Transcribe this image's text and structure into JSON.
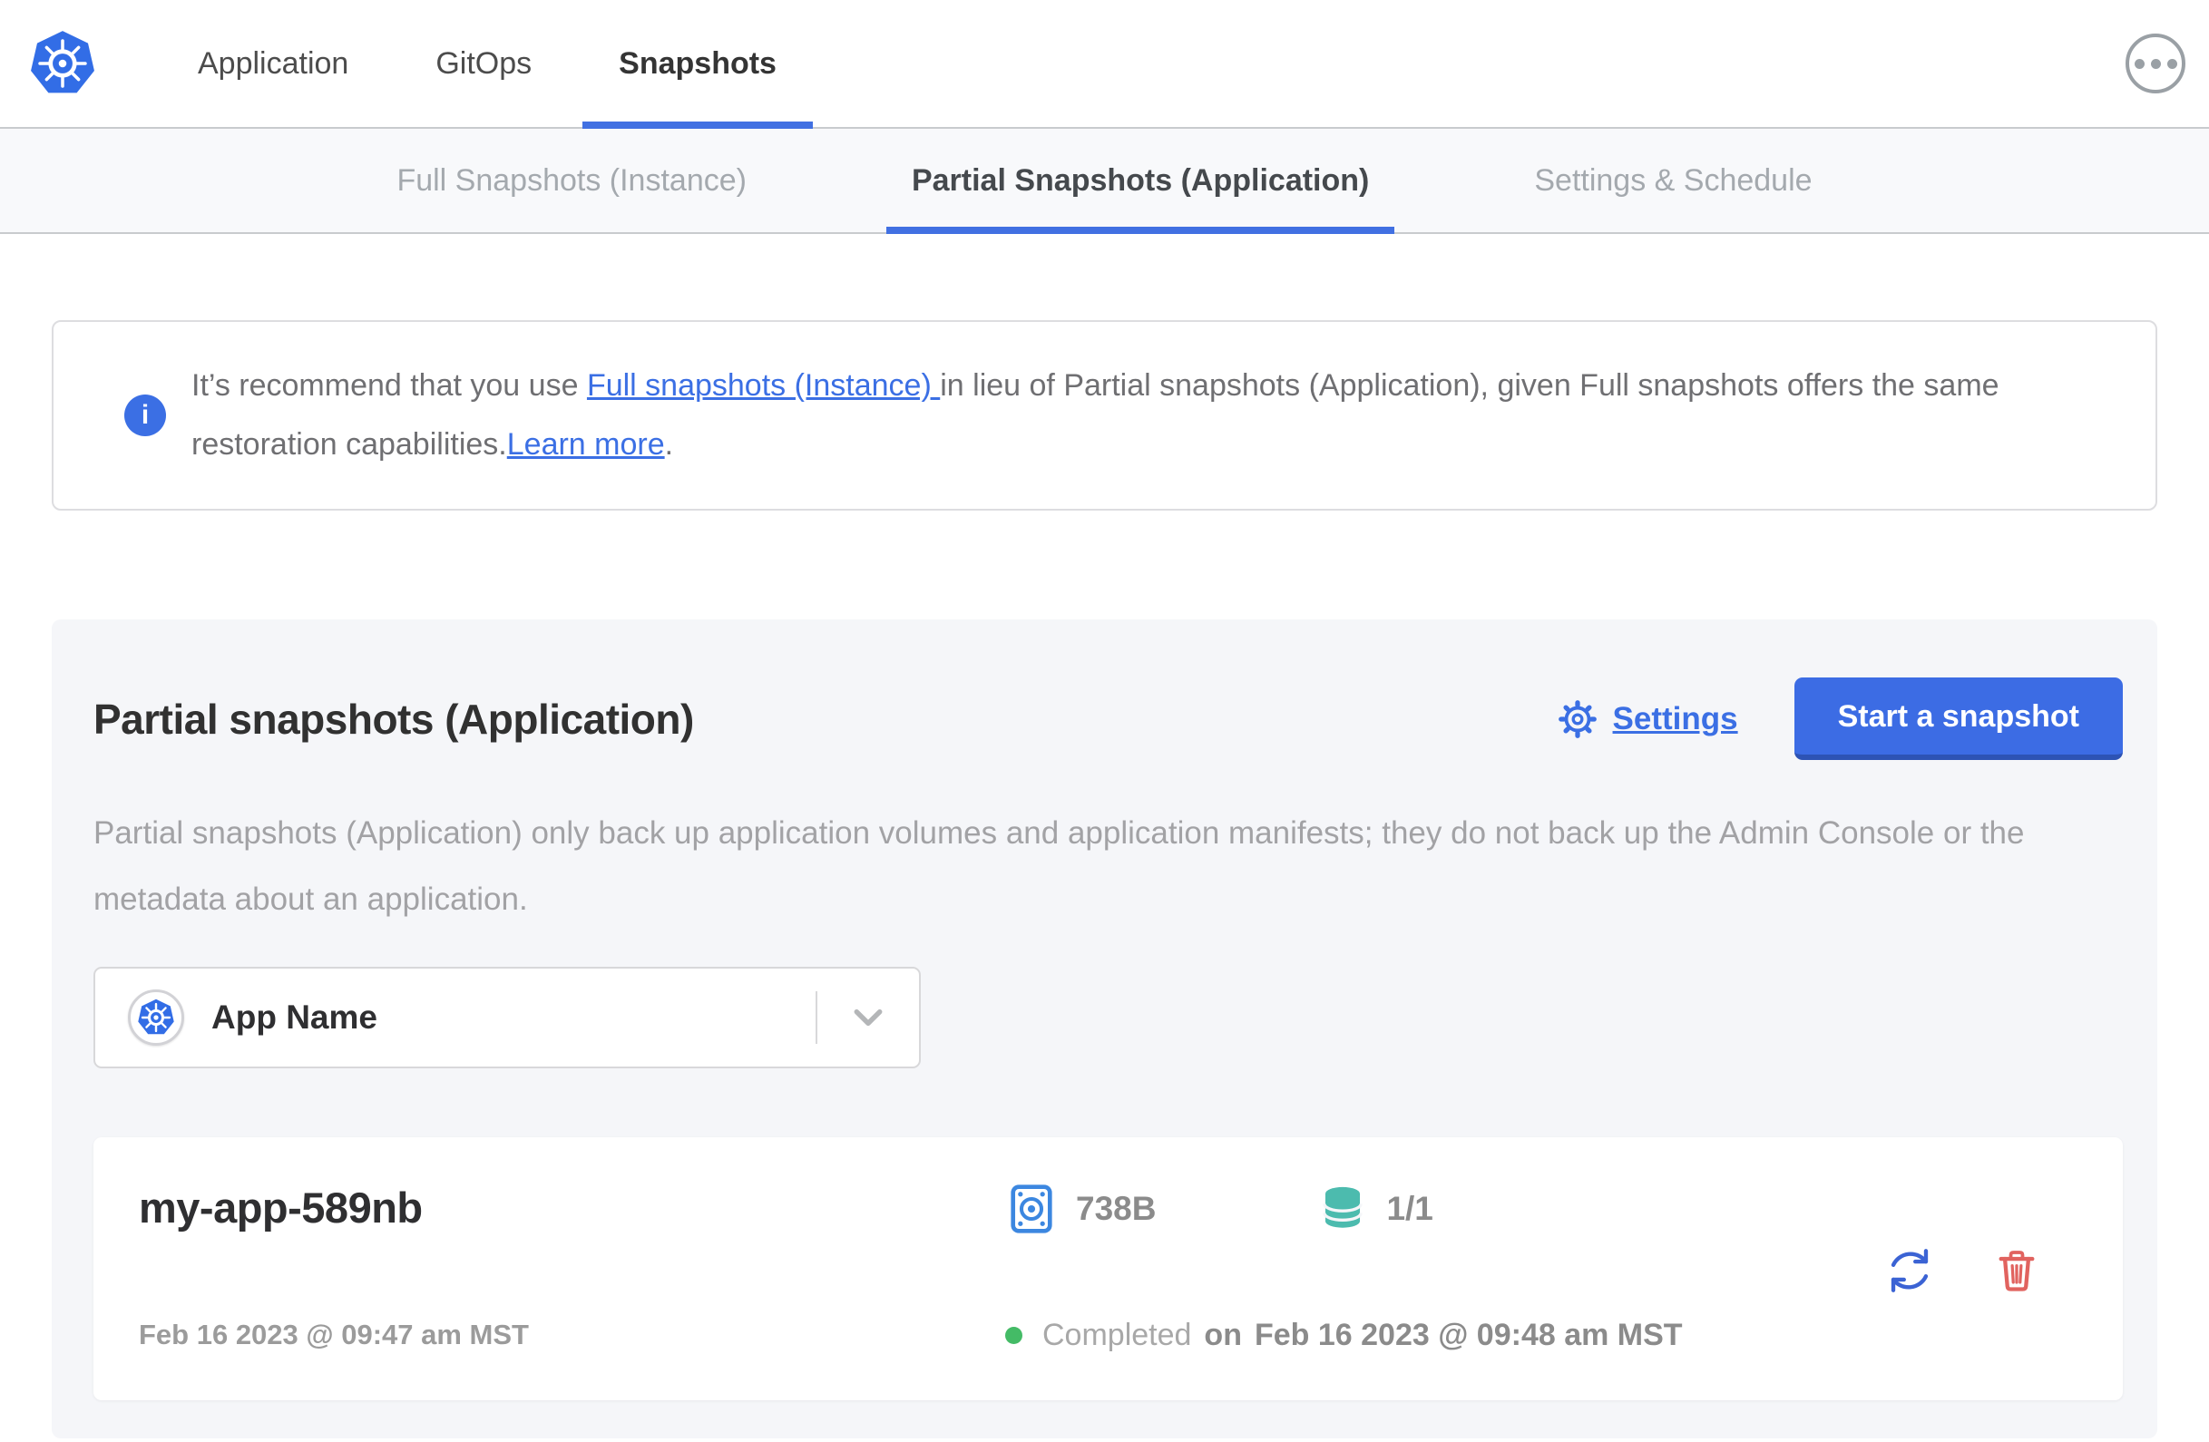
{
  "header": {
    "nav": [
      {
        "label": "Application",
        "active": false
      },
      {
        "label": "GitOps",
        "active": false
      },
      {
        "label": "Snapshots",
        "active": true
      }
    ]
  },
  "subnav": {
    "tabs": [
      {
        "label": "Full Snapshots (Instance)",
        "active": false
      },
      {
        "label": "Partial Snapshots (Application)",
        "active": true
      },
      {
        "label": "Settings & Schedule",
        "active": false
      }
    ]
  },
  "banner": {
    "text_1": "It’s recommend that you use ",
    "link_1": "Full snapshots (Instance) ",
    "text_2": "in lieu of Partial snapshots (Application), given Full snapshots offers the same restoration capabilities.",
    "link_2": "Learn more",
    "text_3": "."
  },
  "main": {
    "title": "Partial snapshots (Application)",
    "settings_label": "Settings",
    "start_button_label": "Start a snapshot",
    "description": "Partial snapshots (Application) only back up application volumes and application manifests; they do not back up the Admin Console or the metadata about an application.",
    "app_selector": {
      "value": "App Name"
    },
    "snapshots": [
      {
        "name": "my-app-589nb",
        "started": "Feb 16 2023 @ 09:47 am MST",
        "size": "738B",
        "volumes": "1/1",
        "status": "Completed",
        "finished_prefix": "on",
        "finished": "Feb 16 2023 @ 09:48 am MST"
      }
    ]
  },
  "icons": {
    "logo": "kubernetes-logo",
    "more": "ellipsis-icon",
    "info": "info-icon",
    "gear": "gear-icon",
    "chevron": "chevron-down-icon",
    "disk": "disk-icon",
    "database": "database-icon",
    "restore": "restore-icon",
    "trash": "trash-icon"
  },
  "colors": {
    "accent_blue": "#3b6fe4",
    "button_blue": "#3c6ce4",
    "kubernetes_blue": "#326de6",
    "disk_blue": "#3c87e0",
    "database_teal": "#4cbbae",
    "status_green": "#44bb66",
    "delete_red": "#e1635f"
  }
}
